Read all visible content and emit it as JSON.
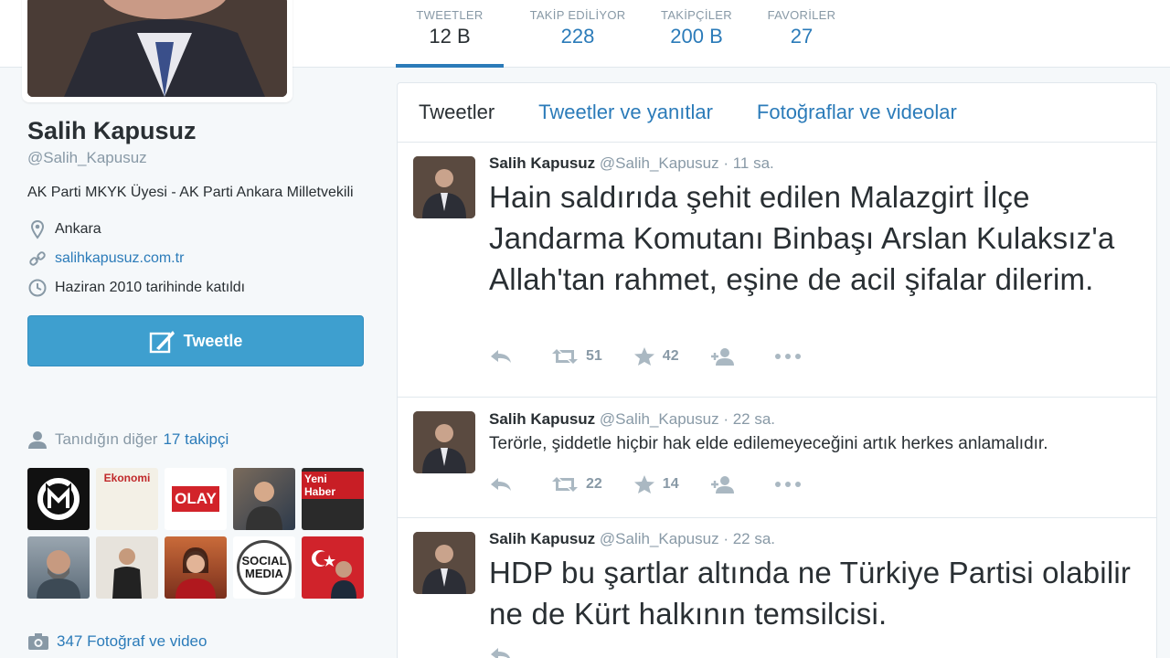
{
  "stats": [
    {
      "label": "TWEETLER",
      "value": "12 B"
    },
    {
      "label": "TAKİP EDİLİYOR",
      "value": "228"
    },
    {
      "label": "TAKİPÇİLER",
      "value": "200 B"
    },
    {
      "label": "FAVORİLER",
      "value": "27"
    }
  ],
  "profile": {
    "name": "Salih Kapusuz",
    "handle": "@Salih_Kapusuz",
    "bio": "AK Parti MKYK Üyesi - AK Parti Ankara Milletvekili",
    "location": "Ankara",
    "website": "salihkapusuz.com.tr",
    "joined": "Haziran 2010 tarihinde katıldı",
    "tweet_button": "Tweetle"
  },
  "followers_known": {
    "prefix": "Tanıdığın diğer",
    "link": "17 takipçi"
  },
  "thumbs": [
    {
      "label": "M"
    },
    {
      "label": "Ekonomi"
    },
    {
      "label": "OLAY"
    },
    {
      "label": ""
    },
    {
      "label": "Yeni Haber"
    },
    {
      "label": ""
    },
    {
      "label": ""
    },
    {
      "label": ""
    },
    {
      "label": "SOCIAL MEDIA"
    },
    {
      "label": ""
    }
  ],
  "photos": "347 Fotoğraf ve video",
  "tabs": [
    "Tweetler",
    "Tweetler ve yanıtlar",
    "Fotoğraflar ve videolar"
  ],
  "tweets": [
    {
      "name": "Salih Kapusuz",
      "handle": "@Salih_Kapusuz",
      "time": "· 11 sa.",
      "text": "Hain saldırıda şehit edilen Malazgirt İlçe Jandarma Komutanı Binbaşı Arslan Kulaksız'a Allah'tan rahmet, eşine de acil şifalar dilerim.",
      "retweets": "51",
      "favorites": "42"
    },
    {
      "name": "Salih Kapusuz",
      "handle": "@Salih_Kapusuz",
      "time": "· 22 sa.",
      "text": "Terörle, şiddetle hiçbir hak elde edilemeyeceğini artık herkes anlamalıdır.",
      "retweets": "22",
      "favorites": "14"
    },
    {
      "name": "Salih Kapusuz",
      "handle": "@Salih_Kapusuz",
      "time": "· 22 sa.",
      "text": "HDP bu şartlar altında ne Türkiye Partisi olabilir ne de Kürt halkının temsilcisi.",
      "retweets": "",
      "favorites": ""
    }
  ]
}
